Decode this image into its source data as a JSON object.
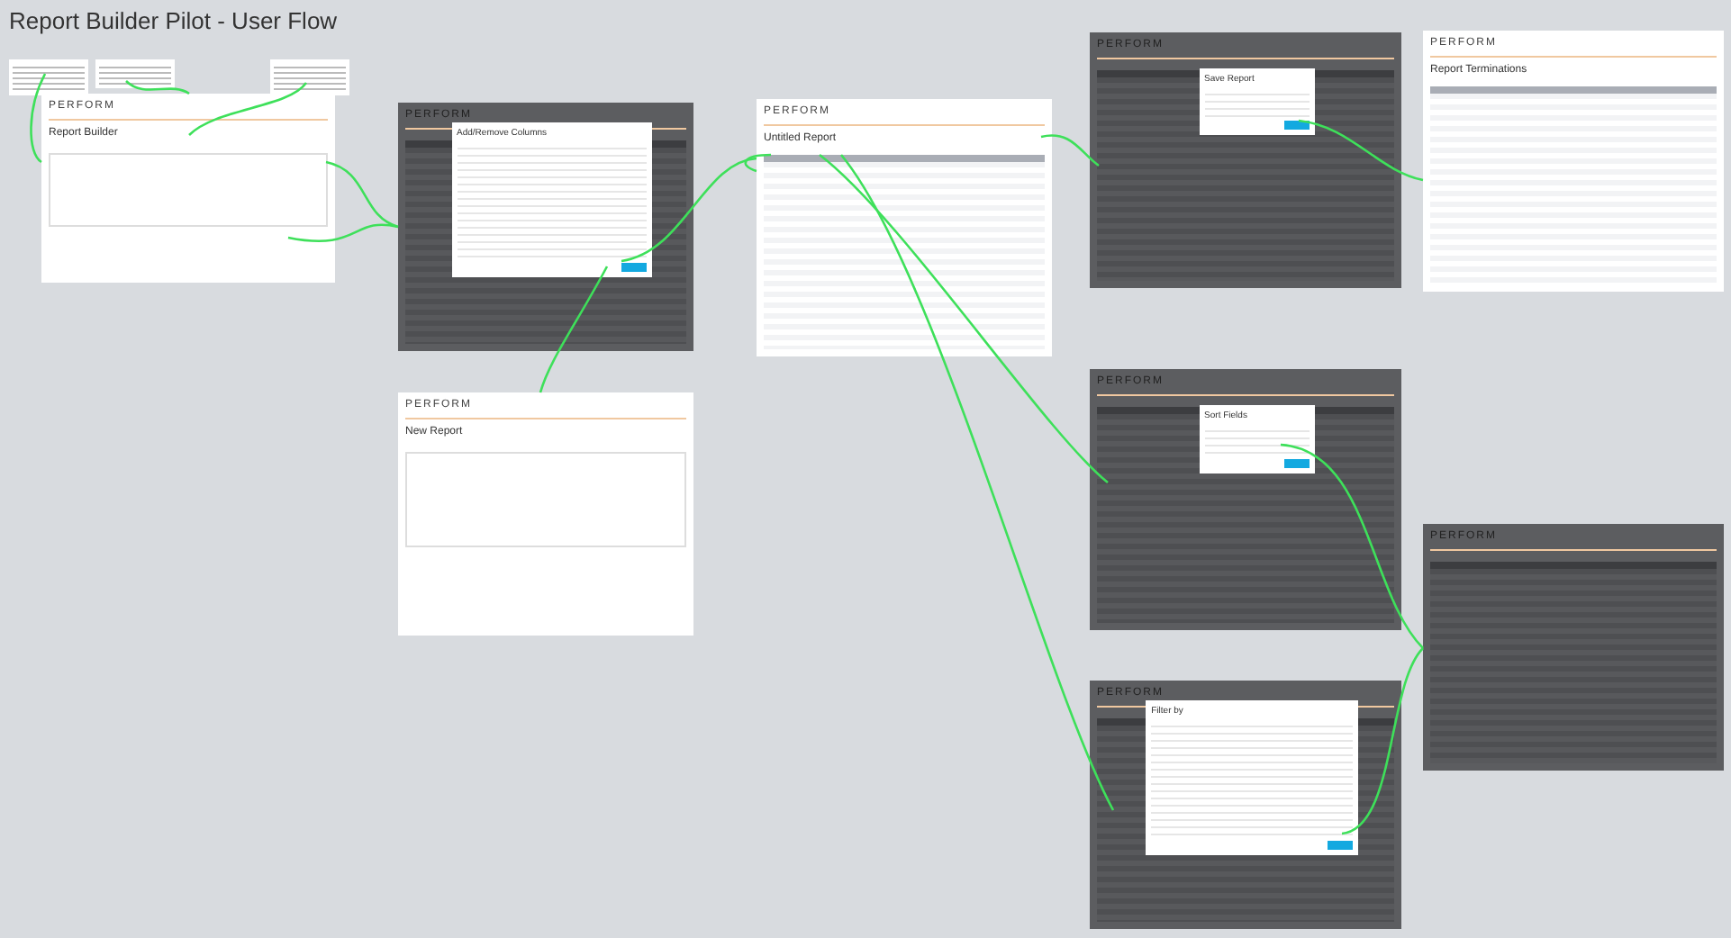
{
  "title": "Report Builder Pilot - User Flow",
  "screens": [
    {
      "kind": "empty",
      "dimmed": false,
      "logo": "PERFORM",
      "heading": "Report Builder"
    },
    {
      "kind": "large_dialog",
      "dimmed": true,
      "logo": "PERFORM",
      "dialog": "Add/Remove Columns"
    },
    {
      "kind": "table",
      "dimmed": false,
      "logo": "PERFORM",
      "heading": "Untitled Report"
    },
    {
      "kind": "small_dialog",
      "dimmed": true,
      "logo": "PERFORM",
      "dialog": "Save Report"
    },
    {
      "kind": "table",
      "dimmed": false,
      "logo": "PERFORM",
      "heading": "Report Terminations"
    },
    {
      "kind": "empty",
      "dimmed": false,
      "logo": "PERFORM",
      "heading": "New Report"
    },
    {
      "kind": "small_dialog",
      "dimmed": true,
      "logo": "PERFORM",
      "dialog": "Sort Fields"
    },
    {
      "kind": "table",
      "dimmed": true,
      "logo": "PERFORM"
    },
    {
      "kind": "large_dialog",
      "dimmed": true,
      "logo": "PERFORM",
      "dialog": "Filter by"
    }
  ]
}
